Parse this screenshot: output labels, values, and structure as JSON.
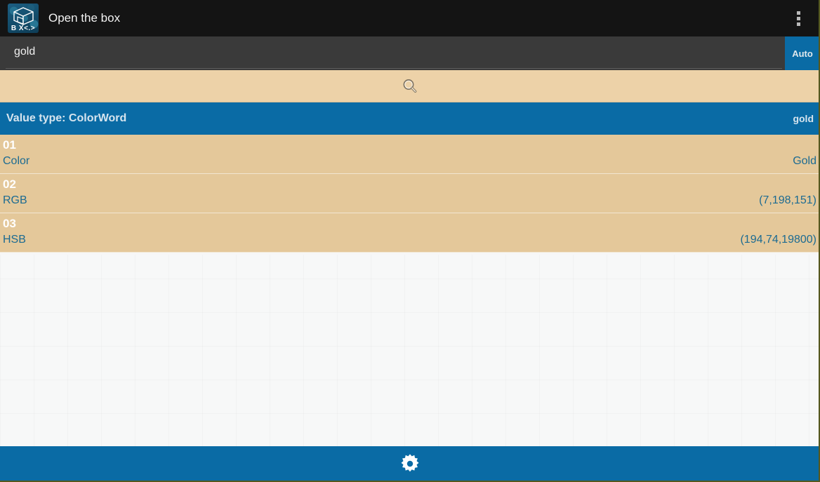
{
  "titlebar": {
    "app_title": "Open the box",
    "icon_name": "cube-app-icon",
    "icon_letters": "B X&lt;.&gt;",
    "overflow_label": "overflow-menu"
  },
  "search": {
    "query_value": "gold",
    "query_placeholder": "",
    "auto_label": "Auto",
    "search_icon": "magnifier-icon"
  },
  "value_type_header": {
    "title": "Value type: ColorWord",
    "query": "gold"
  },
  "results": [
    {
      "index": "01",
      "label": "Color",
      "value": "Gold"
    },
    {
      "index": "02",
      "label": "RGB",
      "value": "(7,198,151)"
    },
    {
      "index": "03",
      "label": "HSB",
      "value": "(194,74,19800)"
    }
  ],
  "bottombar": {
    "settings_icon": "gear-icon"
  },
  "colors": {
    "accent_blue": "#0a6ba5",
    "tan_row": "#e4c89a",
    "tan_strip": "#edd2a8",
    "titlebar_dark": "#141414",
    "query_dark": "#3a3a3a",
    "link_blue": "#1c6b92"
  }
}
